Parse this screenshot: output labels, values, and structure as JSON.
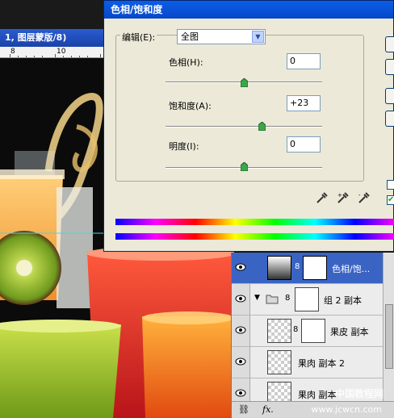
{
  "document": {
    "title": "1, 图层蒙版/8)",
    "ruler_labels": [
      "8",
      "10"
    ]
  },
  "dialog": {
    "title": "色相/饱和度",
    "edit_label": "编辑(E):",
    "edit_value": "全图",
    "hue": {
      "label": "色相(H):",
      "value": "0",
      "slider_percent": 50
    },
    "saturation": {
      "label": "饱和度(A):",
      "value": "+23",
      "slider_percent": 61.5
    },
    "lightness": {
      "label": "明度(I):",
      "value": "0",
      "slider_percent": 50
    },
    "colorize_checked": true,
    "preview_checked": true
  },
  "layers": {
    "items": [
      {
        "name": "色相/饱...",
        "selected": true,
        "type": "adjustment"
      },
      {
        "name": "组 2 副本",
        "selected": false,
        "type": "group"
      },
      {
        "name": "果皮 副本",
        "selected": false,
        "type": "masked"
      },
      {
        "name": "果肉 副本 2",
        "selected": false,
        "type": "pixel"
      },
      {
        "name": "果肉 副本",
        "selected": false,
        "type": "pixel"
      }
    ],
    "footer": {
      "link_icon": "link-icon",
      "fx_label": "fx."
    }
  },
  "watermark": {
    "line1": "中国教程网",
    "line2": "www.jcwcn.com"
  },
  "colors": {
    "dialog_bg": "#ece9d8",
    "title_blue": "#0a5ee8",
    "layer_selected": "#3a64c4"
  }
}
